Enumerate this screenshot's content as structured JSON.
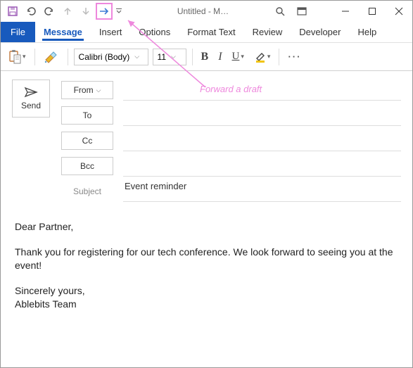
{
  "titlebar": {
    "title": "Untitled  -  M…"
  },
  "tabs": {
    "file": "File",
    "message": "Message",
    "insert": "Insert",
    "options": "Options",
    "formatText": "Format Text",
    "review": "Review",
    "developer": "Developer",
    "help": "Help"
  },
  "ribbon": {
    "fontName": "Calibri (Body)",
    "fontSize": "11",
    "bold": "B",
    "italic": "I",
    "underline": "U"
  },
  "compose": {
    "send": "Send",
    "from": "From",
    "to": "To",
    "cc": "Cc",
    "bcc": "Bcc",
    "subjectLabel": "Subject",
    "subjectValue": "Event reminder"
  },
  "body": {
    "greeting": "Dear Partner,",
    "para1": "Thank you for registering for our tech conference. We look forward to seeing you at the event!",
    "closing1": "Sincerely yours,",
    "closing2": "Ablebits Team"
  },
  "annotation": {
    "text": "Forward a draft"
  }
}
